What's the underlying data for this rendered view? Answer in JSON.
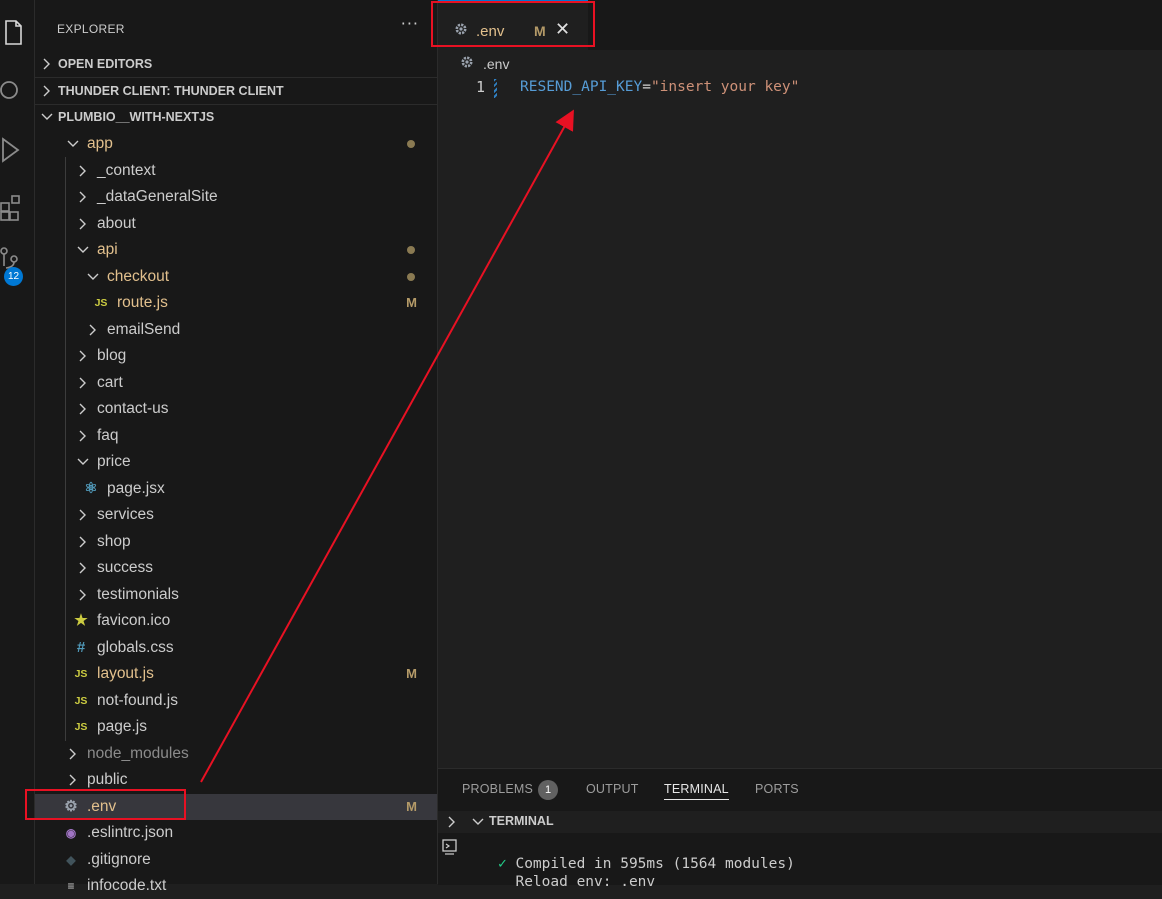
{
  "activity_bar": {
    "icons": [
      "explorer-icon",
      "search-icon",
      "run-debug-icon",
      "extensions-icon",
      "source-control-icon"
    ],
    "source_control_badge": "12"
  },
  "explorer": {
    "title": "EXPLORER",
    "more": "···",
    "sections": {
      "open_editors": "OPEN EDITORS",
      "thunder_client": "THUNDER CLIENT: THUNDER CLIENT",
      "project": "PLUMBIO__WITH-NEXTJS"
    },
    "tree": [
      {
        "label": "app",
        "type": "folder-open",
        "depth": 0,
        "color": "yellow",
        "indicator": "dot"
      },
      {
        "label": "_context",
        "type": "folder",
        "depth": 1
      },
      {
        "label": "_dataGeneralSite",
        "type": "folder",
        "depth": 1
      },
      {
        "label": "about",
        "type": "folder",
        "depth": 1
      },
      {
        "label": "api",
        "type": "folder-open",
        "depth": 1,
        "color": "yellow",
        "indicator": "dot"
      },
      {
        "label": "checkout",
        "type": "folder-open",
        "depth": 2,
        "color": "yellow",
        "indicator": "dot"
      },
      {
        "label": "route.js",
        "type": "js",
        "depth": 3,
        "color": "yellow",
        "indicator": "M"
      },
      {
        "label": "emailSend",
        "type": "folder",
        "depth": 2
      },
      {
        "label": "blog",
        "type": "folder",
        "depth": 1
      },
      {
        "label": "cart",
        "type": "folder",
        "depth": 1
      },
      {
        "label": "contact-us",
        "type": "folder",
        "depth": 1
      },
      {
        "label": "faq",
        "type": "folder",
        "depth": 1
      },
      {
        "label": "price",
        "type": "folder-open",
        "depth": 1
      },
      {
        "label": "page.jsx",
        "type": "react",
        "depth": 2
      },
      {
        "label": "services",
        "type": "folder",
        "depth": 1
      },
      {
        "label": "shop",
        "type": "folder",
        "depth": 1
      },
      {
        "label": "success",
        "type": "folder",
        "depth": 1
      },
      {
        "label": "testimonials",
        "type": "folder",
        "depth": 1
      },
      {
        "label": "favicon.ico",
        "type": "star",
        "depth": 1
      },
      {
        "label": "globals.css",
        "type": "css",
        "depth": 1
      },
      {
        "label": "layout.js",
        "type": "js",
        "depth": 1,
        "color": "yellow",
        "indicator": "M"
      },
      {
        "label": "not-found.js",
        "type": "js",
        "depth": 1
      },
      {
        "label": "page.js",
        "type": "js",
        "depth": 1
      },
      {
        "label": "node_modules",
        "type": "folder",
        "depth": 0,
        "color": "gray"
      },
      {
        "label": "public",
        "type": "folder",
        "depth": 0
      },
      {
        "label": ".env",
        "type": "gear",
        "depth": 0,
        "color": "yellow",
        "indicator": "M",
        "selected": true
      },
      {
        "label": ".eslintrc.json",
        "type": "eslint",
        "depth": 0
      },
      {
        "label": ".gitignore",
        "type": "git",
        "depth": 0
      },
      {
        "label": "infocode.txt",
        "type": "txt",
        "depth": 0
      }
    ]
  },
  "editor": {
    "tab": {
      "name": ".env",
      "status": "M",
      "close": "✕"
    },
    "breadcrumb": ".env",
    "line_number": "1",
    "code": {
      "key": "RESEND_API_KEY",
      "equals": "=",
      "value": "\"insert your key\""
    }
  },
  "panel": {
    "tabs": {
      "problems": "PROBLEMS",
      "problems_count": "1",
      "output": "OUTPUT",
      "terminal": "TERMINAL",
      "ports": "PORTS"
    },
    "section_label": "TERMINAL",
    "terminal_lines": {
      "check": "✓",
      "line1": "Compiled in 595ms (1564 modules)",
      "line2": "Reload env: .env"
    }
  },
  "colors": {
    "annotation": "#e81123",
    "accent": "#0078d4",
    "modified": "#e2c08d"
  }
}
